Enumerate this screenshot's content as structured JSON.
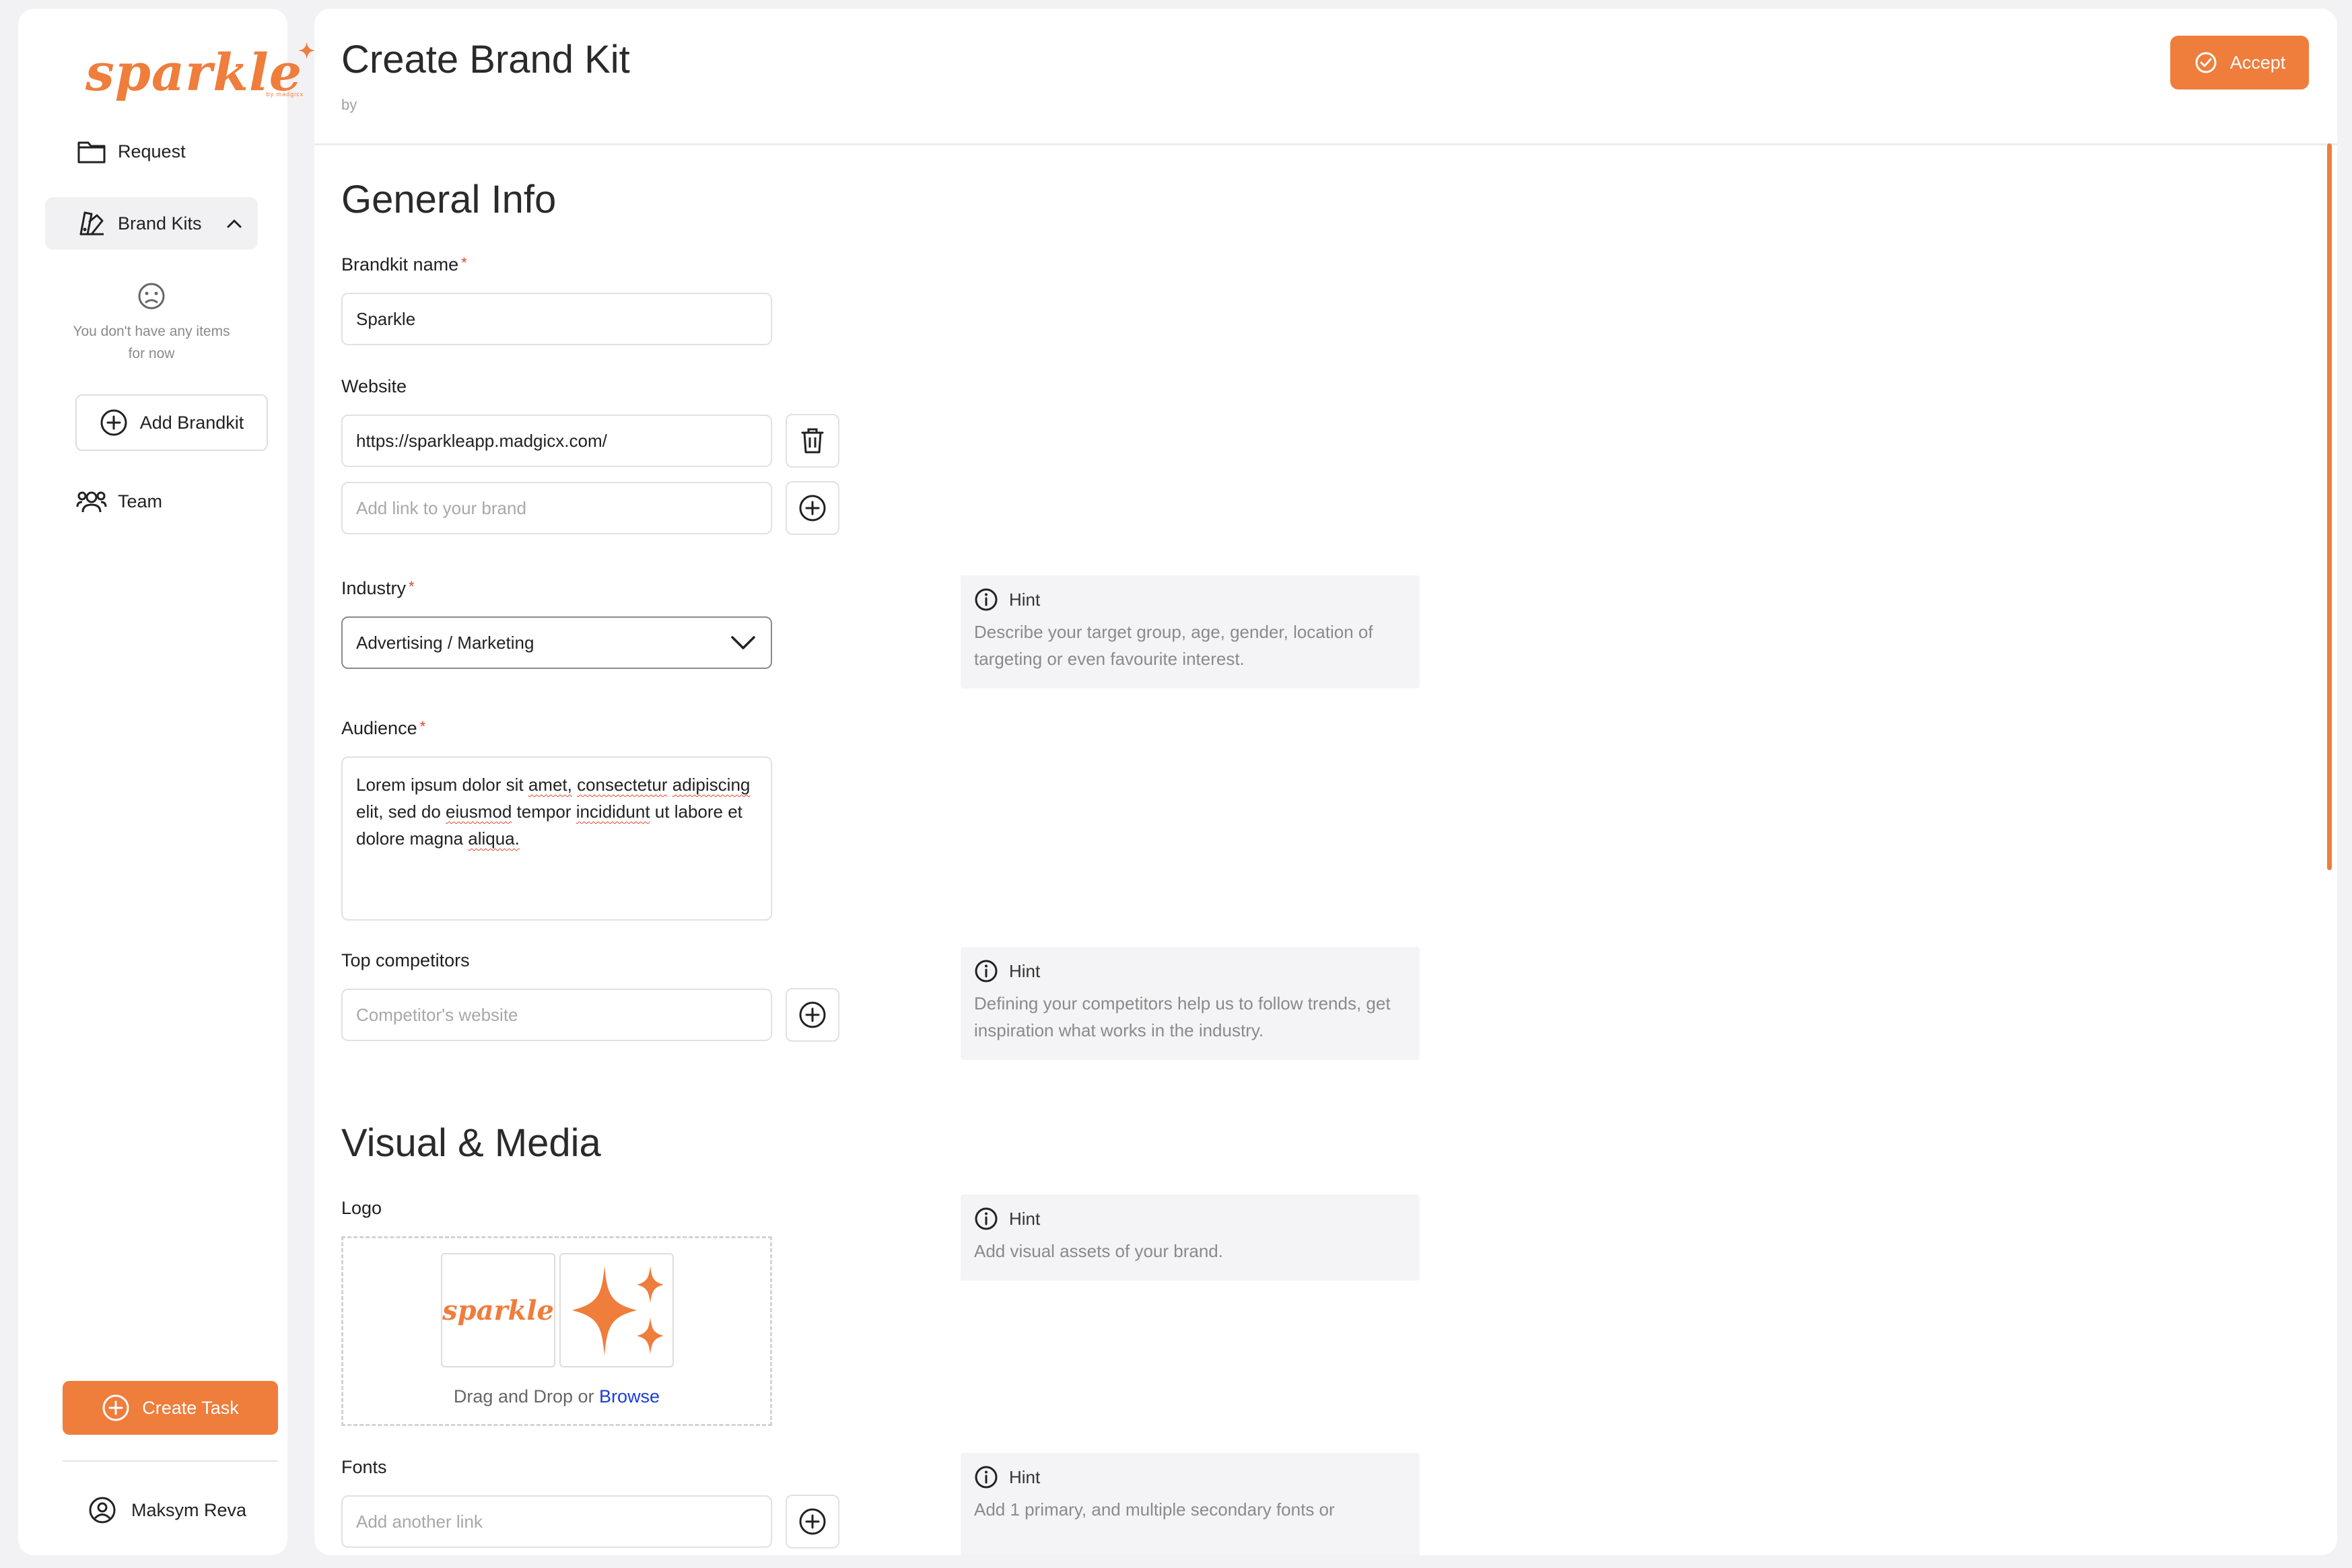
{
  "colors": {
    "accent": "#ef7d3c",
    "required": "#e2442c",
    "link": "#1a3cd8"
  },
  "sidebar": {
    "logo_text": "sparkle",
    "logo_tagline": "by madgicx",
    "nav": {
      "request": {
        "label": "Request",
        "icon": "folder-icon"
      },
      "brand_kits": {
        "label": "Brand Kits",
        "icon": "swatch-book-icon",
        "expanded": true
      },
      "team": {
        "label": "Team",
        "icon": "users-icon"
      }
    },
    "empty_state": {
      "line1": "You don't have any items",
      "line2": "for now",
      "icon": "sad-face-icon"
    },
    "add_brandkit_label": "Add Brandkit",
    "create_task_label": "Create Task",
    "user_name": "Maksym Reva"
  },
  "header": {
    "title": "Create Brand Kit",
    "subtitle": "by",
    "accept_label": "Accept"
  },
  "general_info": {
    "title": "General Info",
    "brandkit_name": {
      "label": "Brandkit name",
      "required": "*",
      "value": "Sparkle"
    },
    "website": {
      "label": "Website",
      "values": [
        "https://sparkleapp.madgicx.com/"
      ],
      "placeholder": "Add link to your brand"
    },
    "industry": {
      "label": "Industry",
      "required": "*",
      "value": "Advertising / Marketing"
    },
    "audience": {
      "label": "Audience",
      "required": "*",
      "value": "Lorem ipsum dolor sit amet, consectetur adipiscing elit, sed do eiusmod tempor incididunt ut labore et dolore magna aliqua."
    },
    "top_competitors": {
      "label": "Top competitors",
      "placeholder": "Competitor's website"
    }
  },
  "hints": {
    "industry": {
      "title": "Hint",
      "text": "Describe your target group, age, gender, location of targeting or even favourite interest."
    },
    "competitors": {
      "title": "Hint",
      "text": "Defining your competitors help us to follow trends, get inspiration what works in the industry."
    },
    "logo": {
      "title": "Hint",
      "text": "Add visual assets of your brand."
    },
    "fonts": {
      "title": "Hint",
      "text": "Add 1 primary, and multiple secondary fonts or"
    }
  },
  "visual_media": {
    "title": "Visual & Media",
    "logo": {
      "label": "Logo",
      "drop_text": "Drag and Drop or",
      "browse_label": "Browse",
      "thumbnails": [
        {
          "type": "wordmark",
          "text": "sparkle"
        },
        {
          "type": "sparkle-icon"
        }
      ]
    },
    "fonts": {
      "label": "Fonts",
      "placeholder": "Add another link"
    }
  }
}
